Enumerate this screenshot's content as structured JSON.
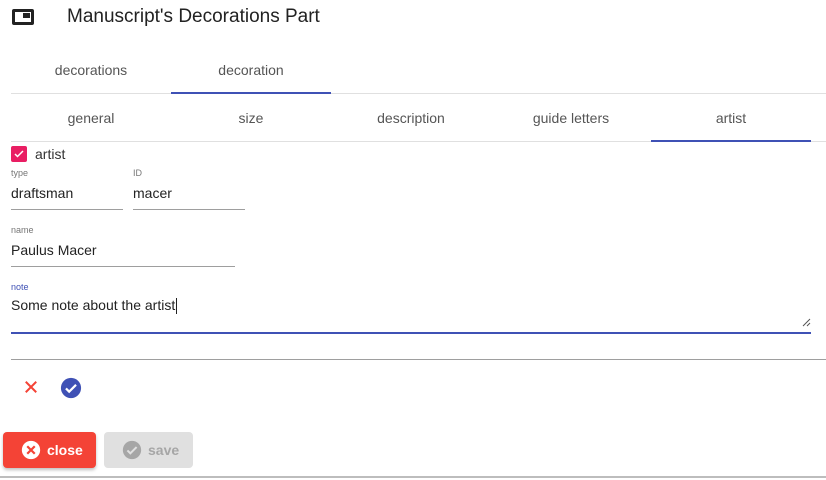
{
  "header": {
    "title": "Manuscript's Decorations Part",
    "icon": "window-icon"
  },
  "tabs_primary": [
    {
      "label": "decorations",
      "active": false
    },
    {
      "label": "decoration",
      "active": true
    }
  ],
  "tabs_secondary": [
    {
      "label": "general",
      "active": false
    },
    {
      "label": "size",
      "active": false
    },
    {
      "label": "description",
      "active": false
    },
    {
      "label": "guide letters",
      "active": false
    },
    {
      "label": "artist",
      "active": true
    }
  ],
  "artist_checkbox": {
    "label": "artist",
    "checked": true,
    "color": "#e91e63"
  },
  "fields": {
    "type": {
      "label": "type",
      "value": "draftsman"
    },
    "id": {
      "label": "ID",
      "value": "macer"
    },
    "name": {
      "label": "name",
      "value": "Paulus Macer"
    },
    "note": {
      "label": "note",
      "value": "Some note about the artist"
    }
  },
  "actions": {
    "cancel_icon": "close-icon",
    "ok_icon": "check-circle-icon"
  },
  "buttons": {
    "close": {
      "label": "close",
      "icon": "cancel-circle-icon",
      "color": "#f44336"
    },
    "save": {
      "label": "save",
      "icon": "check-circle-icon",
      "disabled": true
    }
  },
  "colors": {
    "accent": "#3f51b5",
    "warn": "#f44336",
    "checkbox": "#e91e63"
  }
}
